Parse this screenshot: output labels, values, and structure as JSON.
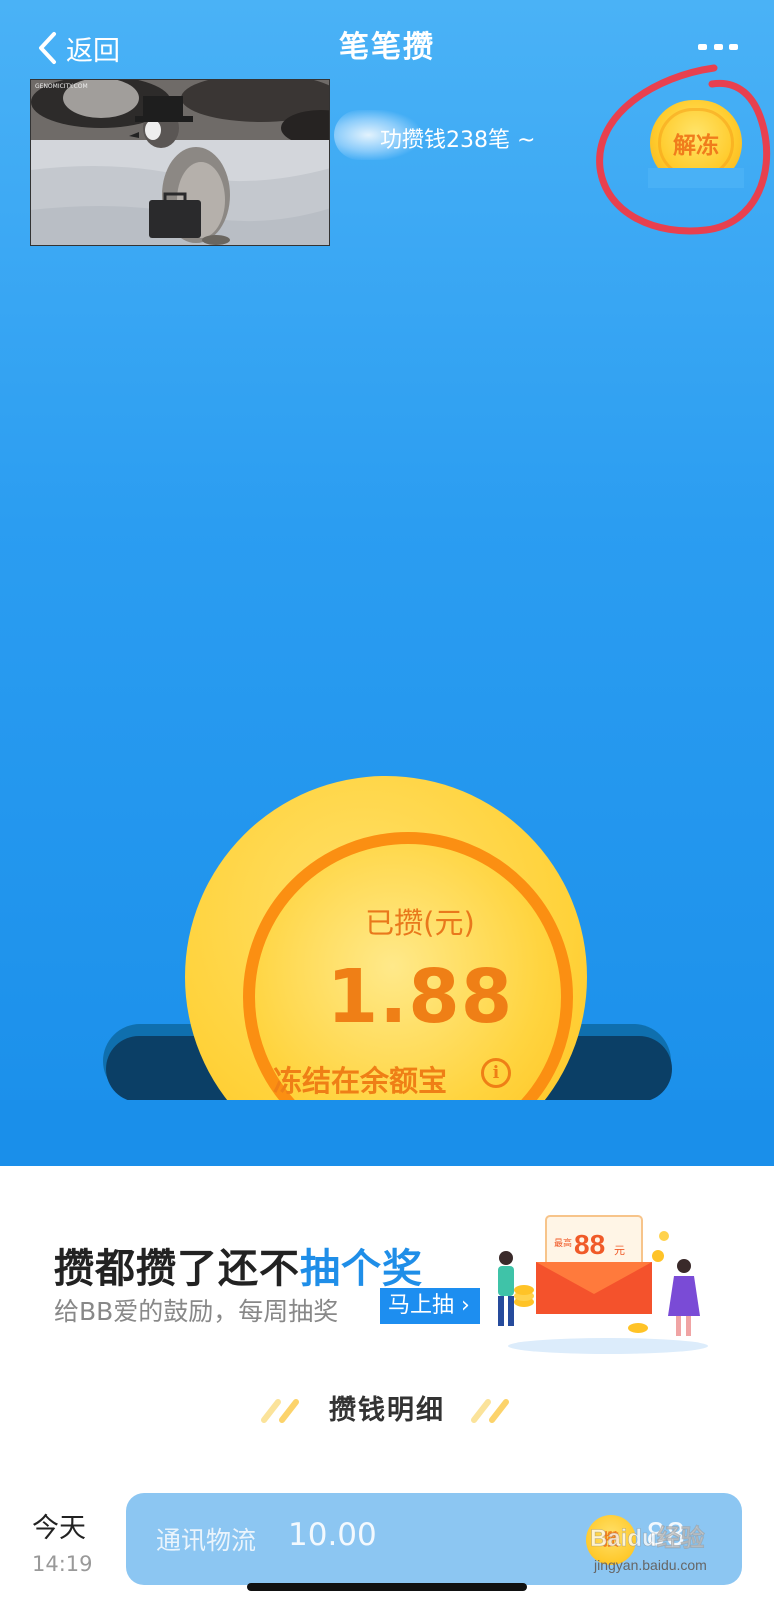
{
  "nav": {
    "back_label": "返回",
    "title": "笔笔攒"
  },
  "notice": {
    "text": "功攒钱238笔 ~"
  },
  "unfreeze": {
    "label": "解冻"
  },
  "savings": {
    "caption": "已攒(元)",
    "amount": "1.88",
    "note": "冻结在余额宝",
    "info_symbol": "i"
  },
  "promo": {
    "title_part1": "攒都攒了还不",
    "title_highlight": "抽个奖",
    "subtitle": "给BB爱的鼓励，每周抽奖",
    "button_label": "马上抽 ›",
    "prize_value": "88",
    "prize_unit": "元",
    "prize_tag": "最高"
  },
  "section": {
    "title": "攒钱明细"
  },
  "records": [
    {
      "day": "今天",
      "time": "14:19",
      "category": "通讯物流",
      "amount": "10.00",
      "coin_label": "攒",
      "partial_value": "88"
    }
  ],
  "watermark": {
    "text1": "Baidu经验",
    "text2": "jingyan.baidu.com"
  },
  "colors": {
    "brand_blue": "#2b9df1",
    "coin_orange": "#ef7f16",
    "coin_gold": "#ffd23a",
    "annotation_red": "#e8404f"
  }
}
